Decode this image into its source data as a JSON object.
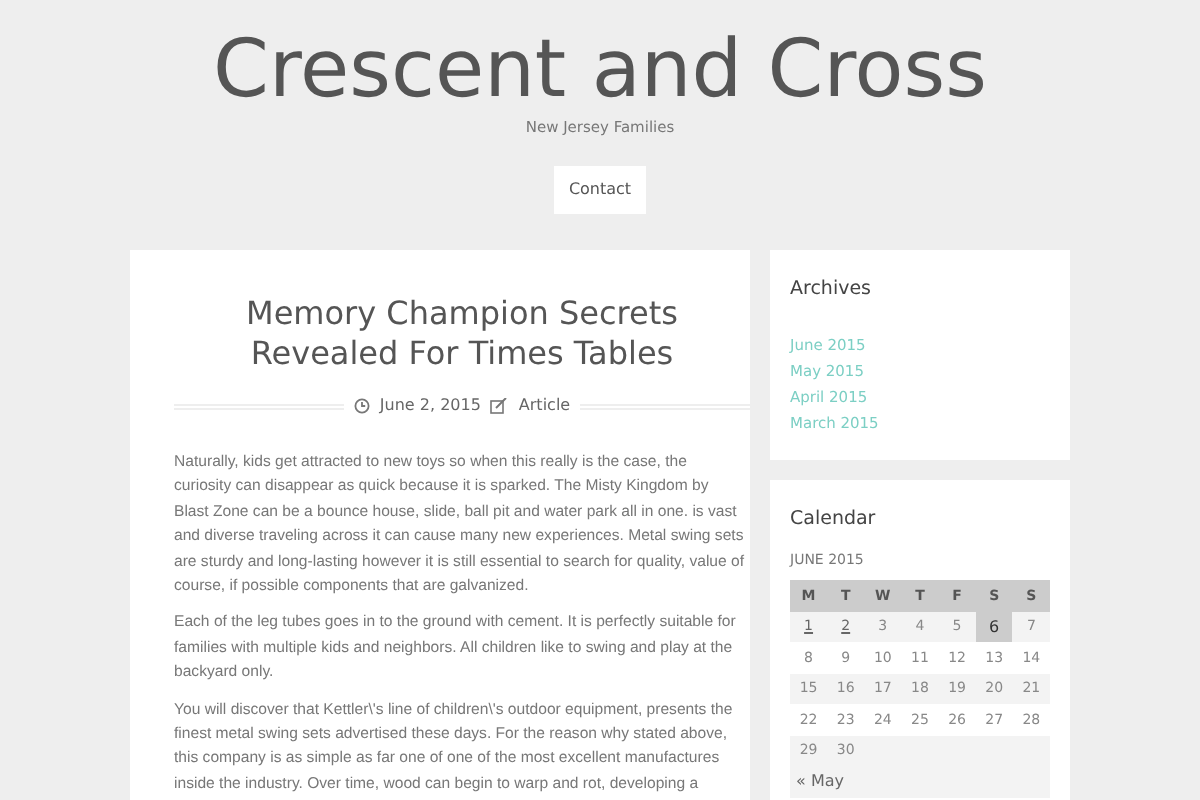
{
  "site": {
    "title": "Crescent and Cross",
    "tagline": "New Jersey Families"
  },
  "nav": [
    {
      "label": "Contact"
    }
  ],
  "post": {
    "title": "Memory Champion Secrets Revealed For Times Tables",
    "date": "June 2, 2015",
    "category": "Article",
    "paragraphs": [
      "Naturally, kids get attracted to new toys so when this really is the case, the curiosity can disappear as quick because it is sparked. The Misty Kingdom by Blast Zone can be a bounce house, slide, ball pit and water park all in one. is vast and diverse traveling across it can cause many new experiences. Metal swing sets are sturdy and long-lasting however it is still essential to search for quality, value of course, if possible components that are galvanized.",
      "Each of the leg tubes goes in to the ground with cement. It is perfectly suitable for families with multiple kids and neighbors. All children like to swing and play at the backyard only.",
      "You will discover that Kettler\\'s line of children\\'s outdoor equipment, presents the finest metal swing sets advertised these days. For the reason why stated above, this company is as simple as far one of one of the most excellent manufactures inside the industry. Over time, wood can begin to warp and rot, developing a"
    ]
  },
  "archives": {
    "title": "Archives",
    "items": [
      "June 2015",
      "May 2015",
      "April 2015",
      "March 2015"
    ]
  },
  "calendar": {
    "title": "Calendar",
    "caption": "JUNE 2015",
    "days": [
      "M",
      "T",
      "W",
      "T",
      "F",
      "S",
      "S"
    ],
    "weeks": [
      [
        {
          "text": "1",
          "link": true,
          "today": false
        },
        {
          "text": "2",
          "link": true,
          "today": false
        },
        {
          "text": "3",
          "link": false,
          "today": false
        },
        {
          "text": "4",
          "link": false,
          "today": false
        },
        {
          "text": "5",
          "link": false,
          "today": false
        },
        {
          "text": "6",
          "link": false,
          "today": true
        },
        {
          "text": "7",
          "link": false,
          "today": false
        }
      ],
      [
        {
          "text": "8",
          "link": false,
          "today": false
        },
        {
          "text": "9",
          "link": false,
          "today": false
        },
        {
          "text": "10",
          "link": false,
          "today": false
        },
        {
          "text": "11",
          "link": false,
          "today": false
        },
        {
          "text": "12",
          "link": false,
          "today": false
        },
        {
          "text": "13",
          "link": false,
          "today": false
        },
        {
          "text": "14",
          "link": false,
          "today": false
        }
      ],
      [
        {
          "text": "15",
          "link": false,
          "today": false
        },
        {
          "text": "16",
          "link": false,
          "today": false
        },
        {
          "text": "17",
          "link": false,
          "today": false
        },
        {
          "text": "18",
          "link": false,
          "today": false
        },
        {
          "text": "19",
          "link": false,
          "today": false
        },
        {
          "text": "20",
          "link": false,
          "today": false
        },
        {
          "text": "21",
          "link": false,
          "today": false
        }
      ],
      [
        {
          "text": "22",
          "link": false,
          "today": false
        },
        {
          "text": "23",
          "link": false,
          "today": false
        },
        {
          "text": "24",
          "link": false,
          "today": false
        },
        {
          "text": "25",
          "link": false,
          "today": false
        },
        {
          "text": "26",
          "link": false,
          "today": false
        },
        {
          "text": "27",
          "link": false,
          "today": false
        },
        {
          "text": "28",
          "link": false,
          "today": false
        }
      ],
      [
        {
          "text": "29",
          "link": false,
          "today": false
        },
        {
          "text": "30",
          "link": false,
          "today": false
        }
      ]
    ],
    "prev": "« May"
  }
}
